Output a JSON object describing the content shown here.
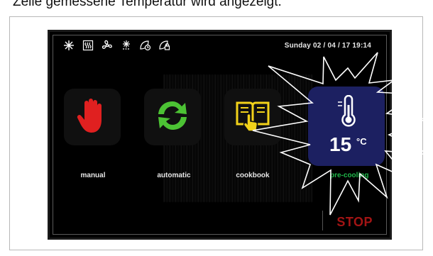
{
  "caption": "Zeile gemessene Temperatur wird angezeigt.",
  "status_bar": {
    "icons": [
      "snowflake-icon",
      "defrost-heater-icon",
      "fan-icon",
      "frost-icon",
      "leaf-clock-icon",
      "leaf-lock-icon"
    ],
    "datetime": "Sunday 02 / 04 / 17  19:14"
  },
  "tiles": [
    {
      "label": "manual",
      "icon": "hand-icon",
      "color": "#e02020"
    },
    {
      "label": "automatic",
      "icon": "cycle-arrows-icon",
      "color": "#4cc234"
    },
    {
      "label": "cookbook",
      "icon": "book-touch-icon",
      "color": "#f2d21a"
    }
  ],
  "precool": {
    "label": "pre-cooling",
    "temperature": "15",
    "unit": "°C",
    "icon": "thermometer-icon",
    "background": "#1c2061",
    "label_color": "#1fb84a"
  },
  "stop_label": "STOP"
}
